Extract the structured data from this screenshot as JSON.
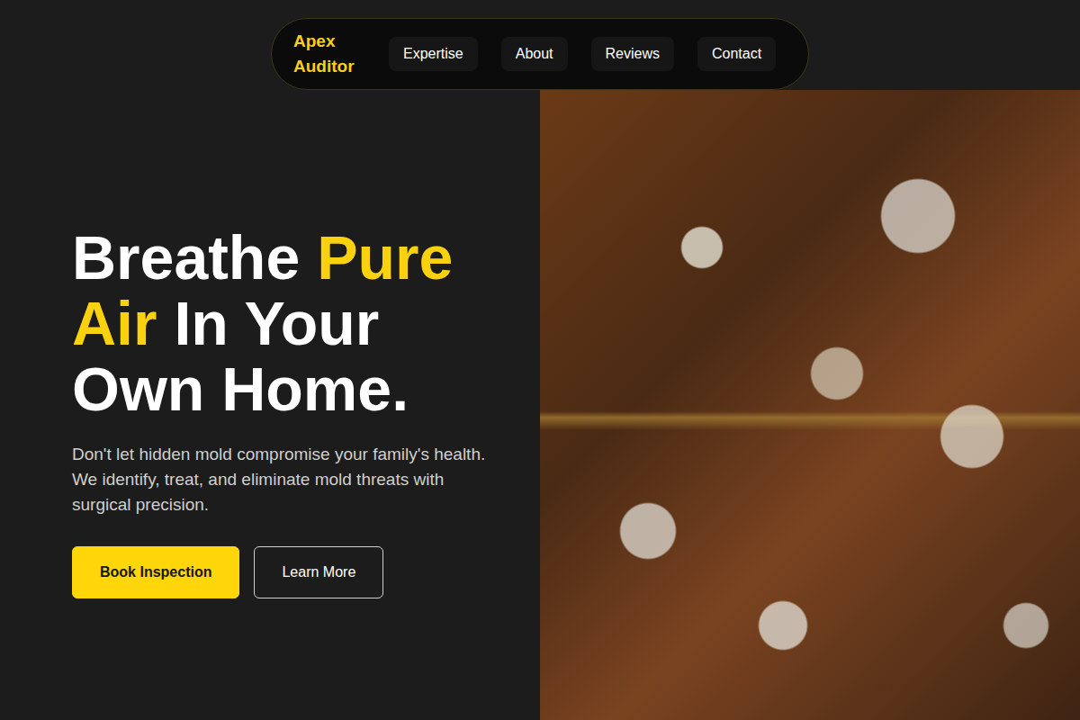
{
  "nav": {
    "logo": "Apex Auditor",
    "items": [
      {
        "label": "Expertise"
      },
      {
        "label": "About"
      },
      {
        "label": "Reviews"
      },
      {
        "label": "Contact"
      }
    ]
  },
  "hero": {
    "headline": [
      {
        "text": "Breathe",
        "highlight": false
      },
      {
        "text": "Pure Air",
        "highlight": true
      },
      {
        "text": "In Your Own Home.",
        "highlight": false
      }
    ],
    "description": "Don't let hidden mold compromise your family's health. We identify, treat, and eliminate mold threats with surgical precision.",
    "buttons": [
      {
        "label": "Book Inspection",
        "kind": "primary"
      },
      {
        "label": "Learn More",
        "kind": "secondary"
      }
    ]
  }
}
